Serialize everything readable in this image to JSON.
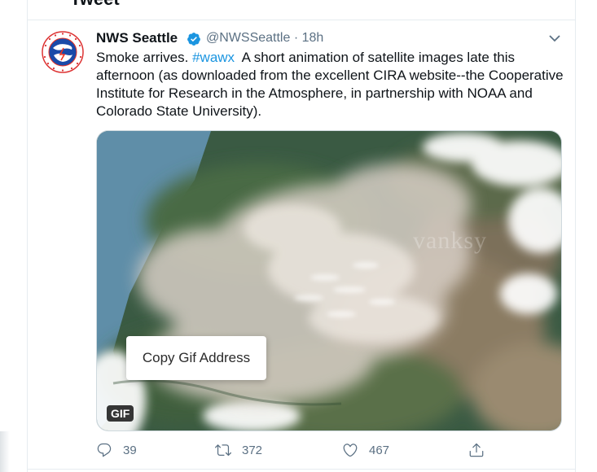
{
  "header": {
    "title": "Tweet"
  },
  "tweet": {
    "author_name": "NWS Seattle",
    "handle": "@NWSSeattle",
    "separator": "·",
    "time": "18h",
    "text_plain_1": "Smoke arrives. ",
    "hashtag": "#wawx",
    "text_plain_2": "  A short animation of satellite images late this afternoon (as downloaded from the excellent CIRA website--the Cooperative Institute for Research in the Atmosphere, in partnership with NOAA and Colorado State University).",
    "avatar_icon": "nws-logo-icon",
    "verified_icon": "verified-badge-icon",
    "menu_icon": "chevron-down-icon"
  },
  "media": {
    "type": "gif",
    "badge": "GIF",
    "watermark": "vanksy",
    "context_menu_item": "Copy Gif Address"
  },
  "actions": {
    "reply": {
      "icon": "reply-icon",
      "count": "39"
    },
    "retweet": {
      "icon": "retweet-icon",
      "count": "372"
    },
    "like": {
      "icon": "heart-icon",
      "count": "467"
    },
    "share": {
      "icon": "share-icon"
    }
  },
  "colors": {
    "accent": "#1b95e0",
    "text": "#0f1419",
    "secondary_text": "#5b7083",
    "divider": "#e6ecf0"
  }
}
